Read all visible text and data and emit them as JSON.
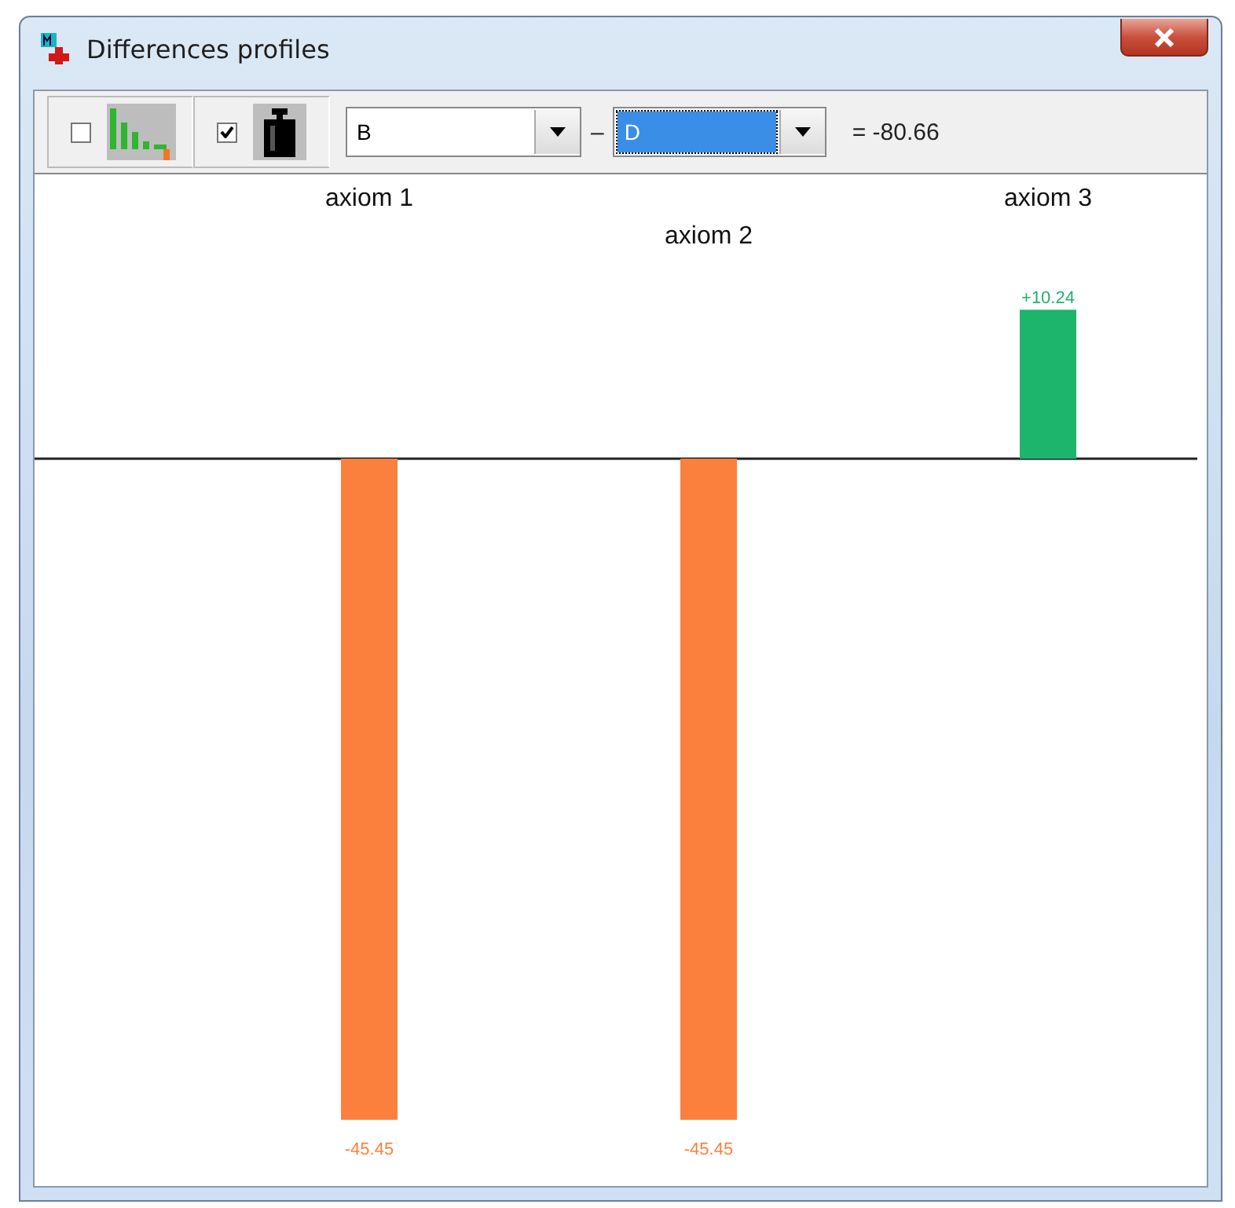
{
  "window": {
    "title": "Differences profiles"
  },
  "toolbar": {
    "show_profiles": {
      "checked": false
    },
    "weights": {
      "checked": true
    },
    "left_profile": {
      "value": "B"
    },
    "operator": "–",
    "right_profile": {
      "value": "D",
      "selected": true
    },
    "result": "= -80.66"
  },
  "chart_data": {
    "type": "bar",
    "categories": [
      "axiom 1",
      "axiom 2",
      "axiom 3"
    ],
    "values": [
      -45.45,
      -45.45,
      10.24
    ],
    "value_labels": [
      "-45.45",
      "-45.45",
      "+10.24"
    ]
  }
}
